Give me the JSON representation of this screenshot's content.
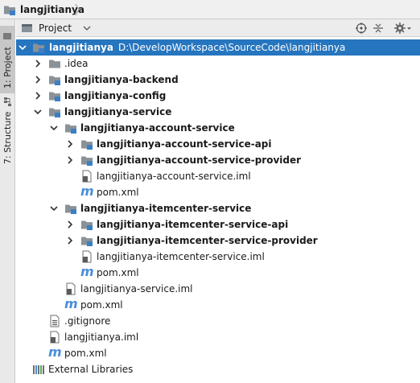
{
  "navbar": {
    "crumb": "langjitianya"
  },
  "strip": {
    "project_tab": "1: Project",
    "structure_tab": "7: Structure"
  },
  "header": {
    "view": "Project"
  },
  "tree": {
    "root": {
      "name": "langjitianya",
      "path": "D:\\DevelopWorkspace\\SourceCode\\langjitianya"
    },
    "idea": ".idea",
    "backend": "langjitianya-backend",
    "config": "langjitianya-config",
    "service": "langjitianya-service",
    "account_service": "langjitianya-account-service",
    "account_api": "langjitianya-account-service-api",
    "account_provider": "langjitianya-account-service-provider",
    "account_iml": "langjitianya-account-service.iml",
    "account_pom": "pom.xml",
    "itemcenter_service": "langjitianya-itemcenter-service",
    "itemcenter_api": "langjitianya-itemcenter-service-api",
    "itemcenter_provider": "langjitianya-itemcenter-service-provider",
    "itemcenter_iml": "langjitianya-itemcenter-service.iml",
    "itemcenter_pom": "pom.xml",
    "service_iml": "langjitianya-service.iml",
    "service_pom": "pom.xml",
    "gitignore": ".gitignore",
    "root_iml": "langjitianya.iml",
    "root_pom": "pom.xml",
    "external": "External Libraries"
  }
}
